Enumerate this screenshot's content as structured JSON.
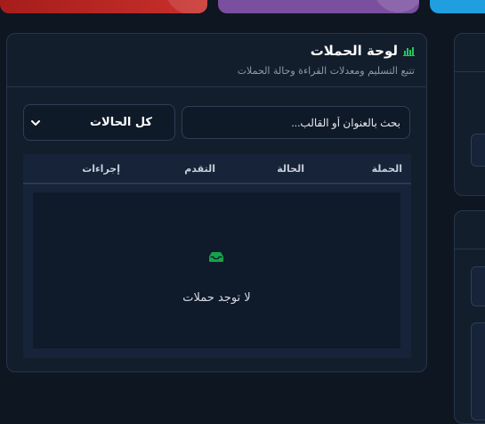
{
  "panel": {
    "title": "لوحة الحملات",
    "subtitle": "تتبع التسليم ومعدلات القراءة وحالة الحملات",
    "title_icon": "bar-chart-icon",
    "title_icon_color": "#22c55e"
  },
  "filters": {
    "status_select_value": "كل الحالات",
    "search_placeholder": "بحث بالعنوان أو القالب..."
  },
  "table": {
    "columns": {
      "campaign": "الحملة",
      "status": "الحالة",
      "progress": "التقدم",
      "actions": "إجراءات"
    },
    "empty_icon": "inbox-icon",
    "empty_icon_color": "#16a34a",
    "empty_text": "لا توجد حملات"
  },
  "colors": {
    "background": "#0e1621",
    "panel": "#131e2c",
    "stat_red": "#b52622",
    "stat_purple": "#7a4f9f",
    "stat_blue": "#1f9fe0"
  }
}
